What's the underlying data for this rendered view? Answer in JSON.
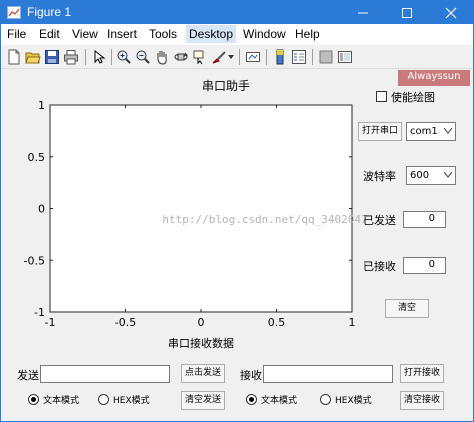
{
  "window": {
    "title": "Figure 1"
  },
  "menu": [
    "File",
    "Edit",
    "View",
    "Insert",
    "Tools",
    "Desktop",
    "Window",
    "Help"
  ],
  "figure": {
    "badge": "Alwayssun",
    "watermark": "http://blog.csdn.net/qq_3402047",
    "enable_plot_label": "使能绘图",
    "enable_plot_checked": false,
    "open_port_button": "打开串口",
    "port_select": "com1",
    "baud_label": "波特率",
    "baud_select": "600",
    "sent_label": "已发送",
    "sent_count": "0",
    "received_label": "已接收",
    "received_count": "0",
    "clear_button": "清空",
    "send_label": "发送",
    "send_input": "",
    "click_send_button": "点击发送",
    "receive_label": "接收",
    "receive_input": "",
    "open_receive_button": "打开接收",
    "send_text_mode": "文本模式",
    "send_hex_mode": "HEX模式",
    "clear_send_button": "清空发送",
    "recv_text_mode": "文本模式",
    "recv_hex_mode": "HEX模式",
    "clear_receive_button": "清空接收"
  },
  "chart_data": {
    "type": "line",
    "title": "串口助手",
    "xlabel": "串口接收数据",
    "ylabel": "",
    "xlim": [
      -1,
      1
    ],
    "ylim": [
      -1,
      1
    ],
    "xticks": [
      "-1",
      "-0.5",
      "0",
      "0.5",
      "1"
    ],
    "yticks": [
      "1",
      "0.5",
      "0",
      "-0.5",
      "-1"
    ],
    "series": [],
    "grid": false
  },
  "colors": {
    "titlebar": "#2b7bd6",
    "badge": "#c97b7b",
    "menu_highlight": "#d7e6f6"
  },
  "icons": {
    "toolbar": [
      "new-figure-icon",
      "open-file-icon",
      "save-icon",
      "print-icon",
      "edit-plot-arrow-icon",
      "zoom-in-icon",
      "zoom-out-icon",
      "pan-hand-icon",
      "rotate-3d-icon",
      "data-cursor-icon",
      "brush-icon",
      "link-plot-icon",
      "insert-colorbar-icon",
      "insert-legend-icon",
      "hide-plot-tools-icon",
      "show-plot-tools-icon"
    ]
  }
}
